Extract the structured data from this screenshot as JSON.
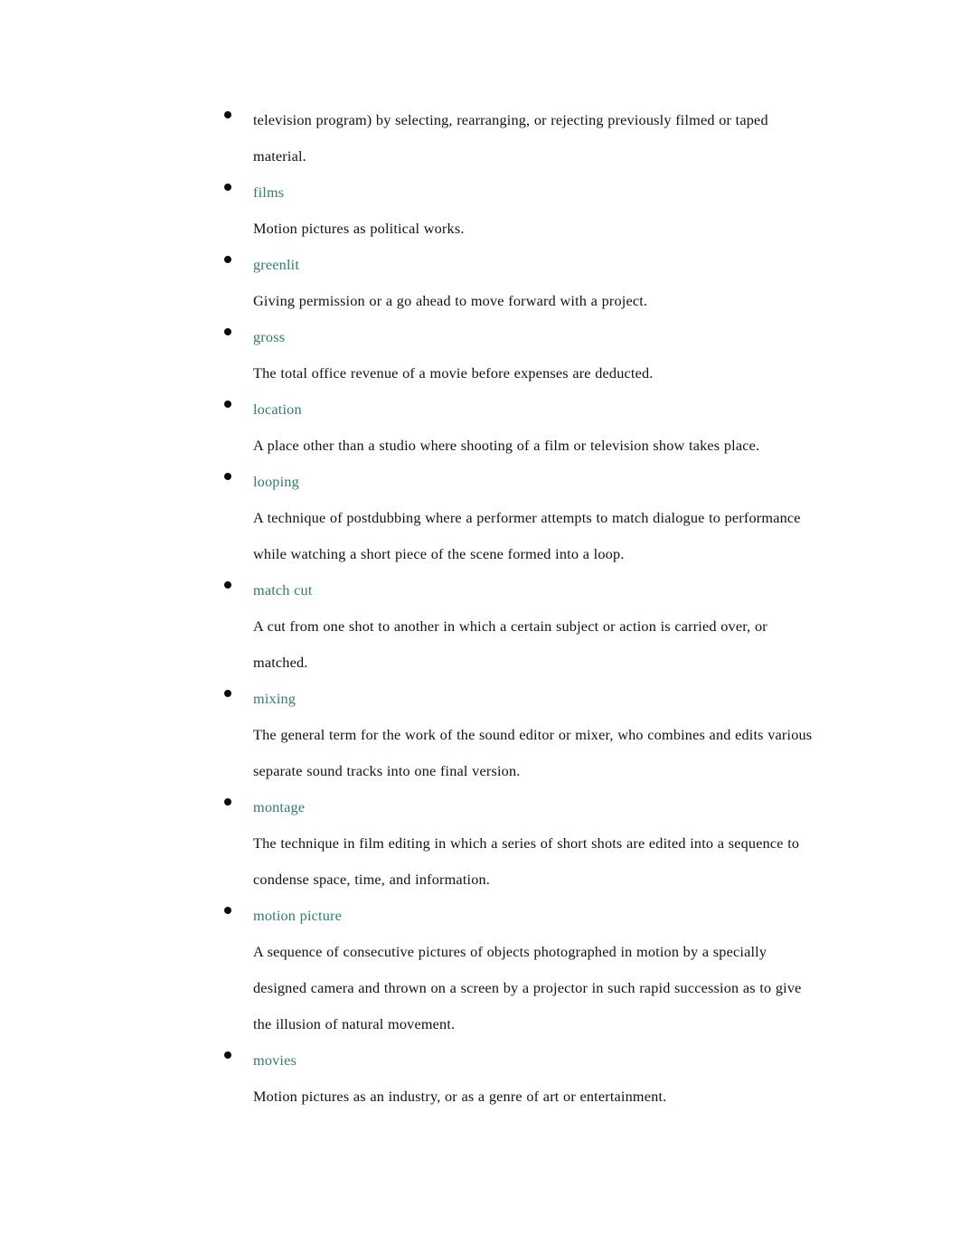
{
  "document": {
    "type": "glossary",
    "page_background": "#ffffff",
    "term_color": "#2e7d6e",
    "text_color": "#121212",
    "bullet_glyph": "bullet",
    "entries": [
      {
        "term": " television program) by selecting, rearranging, or rejecting previously filmed or taped material.",
        "term_is_continuation": true,
        "definition": ""
      },
      {
        "term": "films",
        "term_is_continuation": false,
        "definition": "Motion pictures as political works."
      },
      {
        "term": "greenlit",
        "term_is_continuation": false,
        "definition": "Giving permission or a go ahead to move forward with a project."
      },
      {
        "term": "gross",
        "term_is_continuation": false,
        "definition": "The total office revenue of a movie before expenses are deducted."
      },
      {
        "term": "location",
        "term_is_continuation": false,
        "definition": "A place other than a studio where shooting of a film or television show takes place."
      },
      {
        "term": "looping",
        "term_is_continuation": false,
        "definition": "A technique of postdubbing where a performer attempts to match dialogue to performance while watching a short piece of the scene formed into a loop."
      },
      {
        "term": "match cut",
        "term_is_continuation": false,
        "definition": "A cut from one shot to another in which a certain subject or action is carried over, or matched."
      },
      {
        "term": "mixing",
        "term_is_continuation": false,
        "definition": "The general term for the work of the sound editor or mixer, who combines and edits various separate sound tracks into one final version."
      },
      {
        "term": "montage",
        "term_is_continuation": false,
        "definition": "The technique in film editing in which a series of short shots are edited into a sequence to condense space, time, and information."
      },
      {
        "term": "motion picture",
        "term_is_continuation": false,
        "definition": "A sequence of consecutive pictures of objects photographed in motion by a specially designed camera and thrown on a screen by a projector in such rapid succession as to give the illusion of natural movement."
      },
      {
        "term": "movies",
        "term_is_continuation": false,
        "definition": "Motion pictures as an industry, or as a genre of art or entertainment."
      }
    ]
  }
}
